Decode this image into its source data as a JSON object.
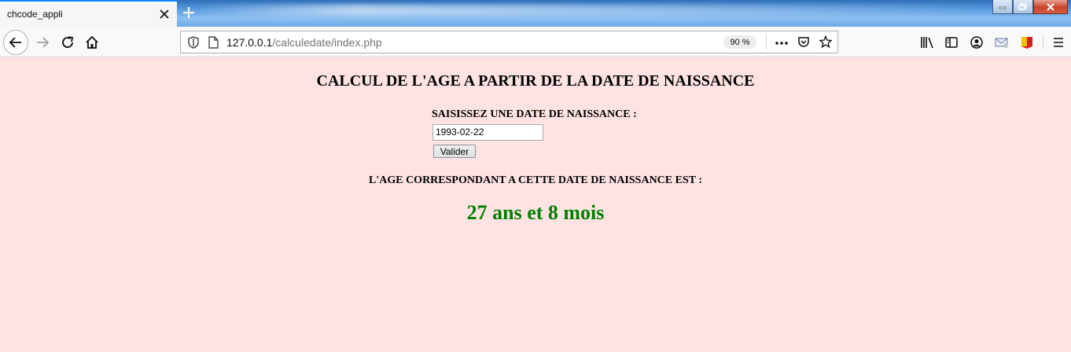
{
  "browser": {
    "tab_title": "chcode_appli",
    "url_host": "127.0.0.1",
    "url_path": "/calculedate/index.php",
    "zoom": "90 %"
  },
  "page": {
    "heading": "CALCUL DE L'AGE A PARTIR DE LA DATE DE NAISSANCE",
    "input_label": "SAISISSEZ UNE DATE DE NAISSANCE :",
    "date_value": "1993-02-22",
    "submit_label": "Valider",
    "result_label": "L'AGE CORRESPONDANT A CETTE DATE DE NAISSANCE EST :",
    "result_value": "27 ans et 8 mois",
    "colors": {
      "background": "#ffe3e3",
      "result": "#008000"
    }
  },
  "icons": [
    "close-icon",
    "new-tab-icon",
    "minimize-icon",
    "restore-icon",
    "window-close-icon",
    "back-icon",
    "forward-icon",
    "reload-icon",
    "home-icon",
    "shield-icon",
    "page-icon",
    "more-icon",
    "pocket-icon",
    "bookmark-star-icon",
    "library-icon",
    "sidebar-icon",
    "account-icon",
    "mail-icon",
    "flag-icon",
    "menu-icon"
  ]
}
